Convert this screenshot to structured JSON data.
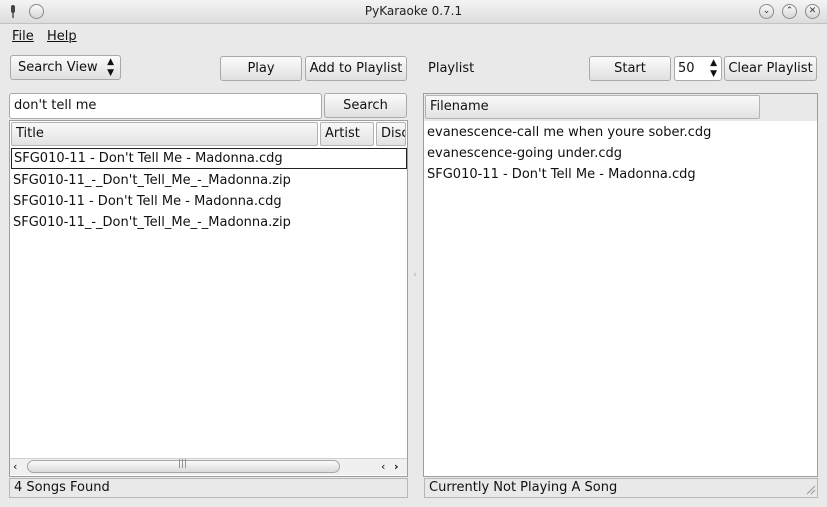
{
  "window": {
    "title": "PyKaraoke 0.7.1"
  },
  "menu": {
    "file": "File",
    "help": "Help"
  },
  "left": {
    "view_select": "Search View",
    "play_label": "Play",
    "add_label": "Add to Playlist",
    "search_value": "don't tell me",
    "search_button": "Search",
    "columns": [
      "Title",
      "Artist",
      "Disc"
    ],
    "rows": [
      "SFG010-11 - Don't Tell Me - Madonna.cdg",
      "SFG010-11_-_Don't_Tell_Me_-_Madonna.zip",
      "SFG010-11 - Don't Tell Me - Madonna.cdg",
      "SFG010-11_-_Don't_Tell_Me_-_Madonna.zip"
    ],
    "status": "4 Songs Found"
  },
  "right": {
    "playlist_label": "Playlist",
    "start_label": "Start",
    "volume_value": "50",
    "clear_label": "Clear Playlist",
    "column": "Filename",
    "rows": [
      "evanescence-call me when youre sober.cdg",
      "evanescence-going under.cdg",
      "SFG010-11 - Don't Tell Me - Madonna.cdg"
    ],
    "status": "Currently Not Playing A Song"
  }
}
